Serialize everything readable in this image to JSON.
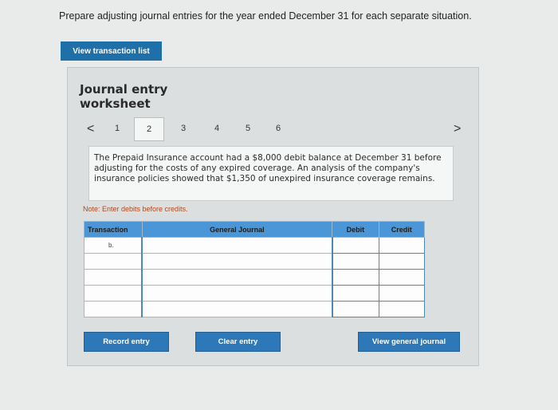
{
  "instructions": "Prepare adjusting journal entries for the year ended December 31 for each separate situation.",
  "view_transaction_list_label": "View transaction list",
  "worksheet_title": "Journal entry worksheet",
  "pager": {
    "prev": "<",
    "next": ">",
    "pages": [
      "1",
      "2",
      "3",
      "4",
      "5",
      "6"
    ],
    "active_page": "2"
  },
  "scenario_text": "The Prepaid Insurance account had a $8,000 debit balance at December 31 before adjusting for the costs of any expired coverage. An analysis of the company's insurance policies showed that $1,350 of unexpired insurance coverage remains.",
  "note": "Note: Enter debits before credits.",
  "table": {
    "headers": [
      "Transaction",
      "General Journal",
      "Debit",
      "Credit"
    ],
    "rows": [
      {
        "transaction": "b.",
        "general_journal": "",
        "debit": "",
        "credit": ""
      },
      {
        "transaction": "",
        "general_journal": "",
        "debit": "",
        "credit": ""
      },
      {
        "transaction": "",
        "general_journal": "",
        "debit": "",
        "credit": ""
      },
      {
        "transaction": "",
        "general_journal": "",
        "debit": "",
        "credit": ""
      },
      {
        "transaction": "",
        "general_journal": "",
        "debit": "",
        "credit": ""
      }
    ]
  },
  "buttons": {
    "record_entry": "Record entry",
    "clear_entry": "Clear entry",
    "view_general_journal": "View general journal"
  },
  "colors": {
    "primary_button": "#2d78b8",
    "header_blue": "#4a96d6",
    "note_text": "#b24a1c"
  }
}
